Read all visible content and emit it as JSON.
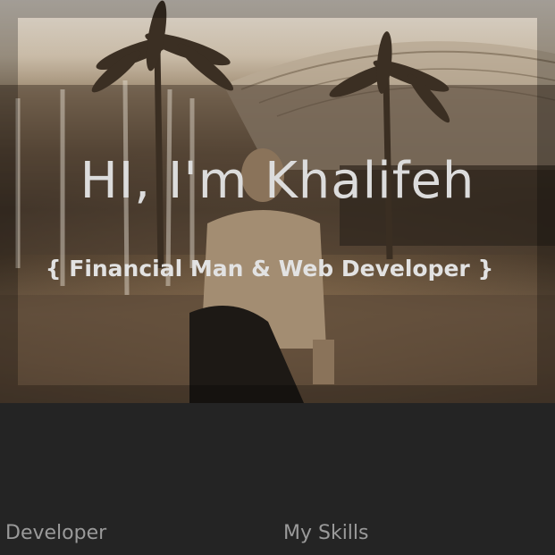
{
  "hero": {
    "title": "HI, I'm Khalifeh",
    "subtitle": "{ Financial Man & Web Developer }"
  },
  "sections": {
    "left_label": "Developer",
    "right_label": "My Skills"
  },
  "colors": {
    "page_background": "#242424",
    "title_text": "#dcdcdc",
    "label_text": "#9a9a9a"
  }
}
